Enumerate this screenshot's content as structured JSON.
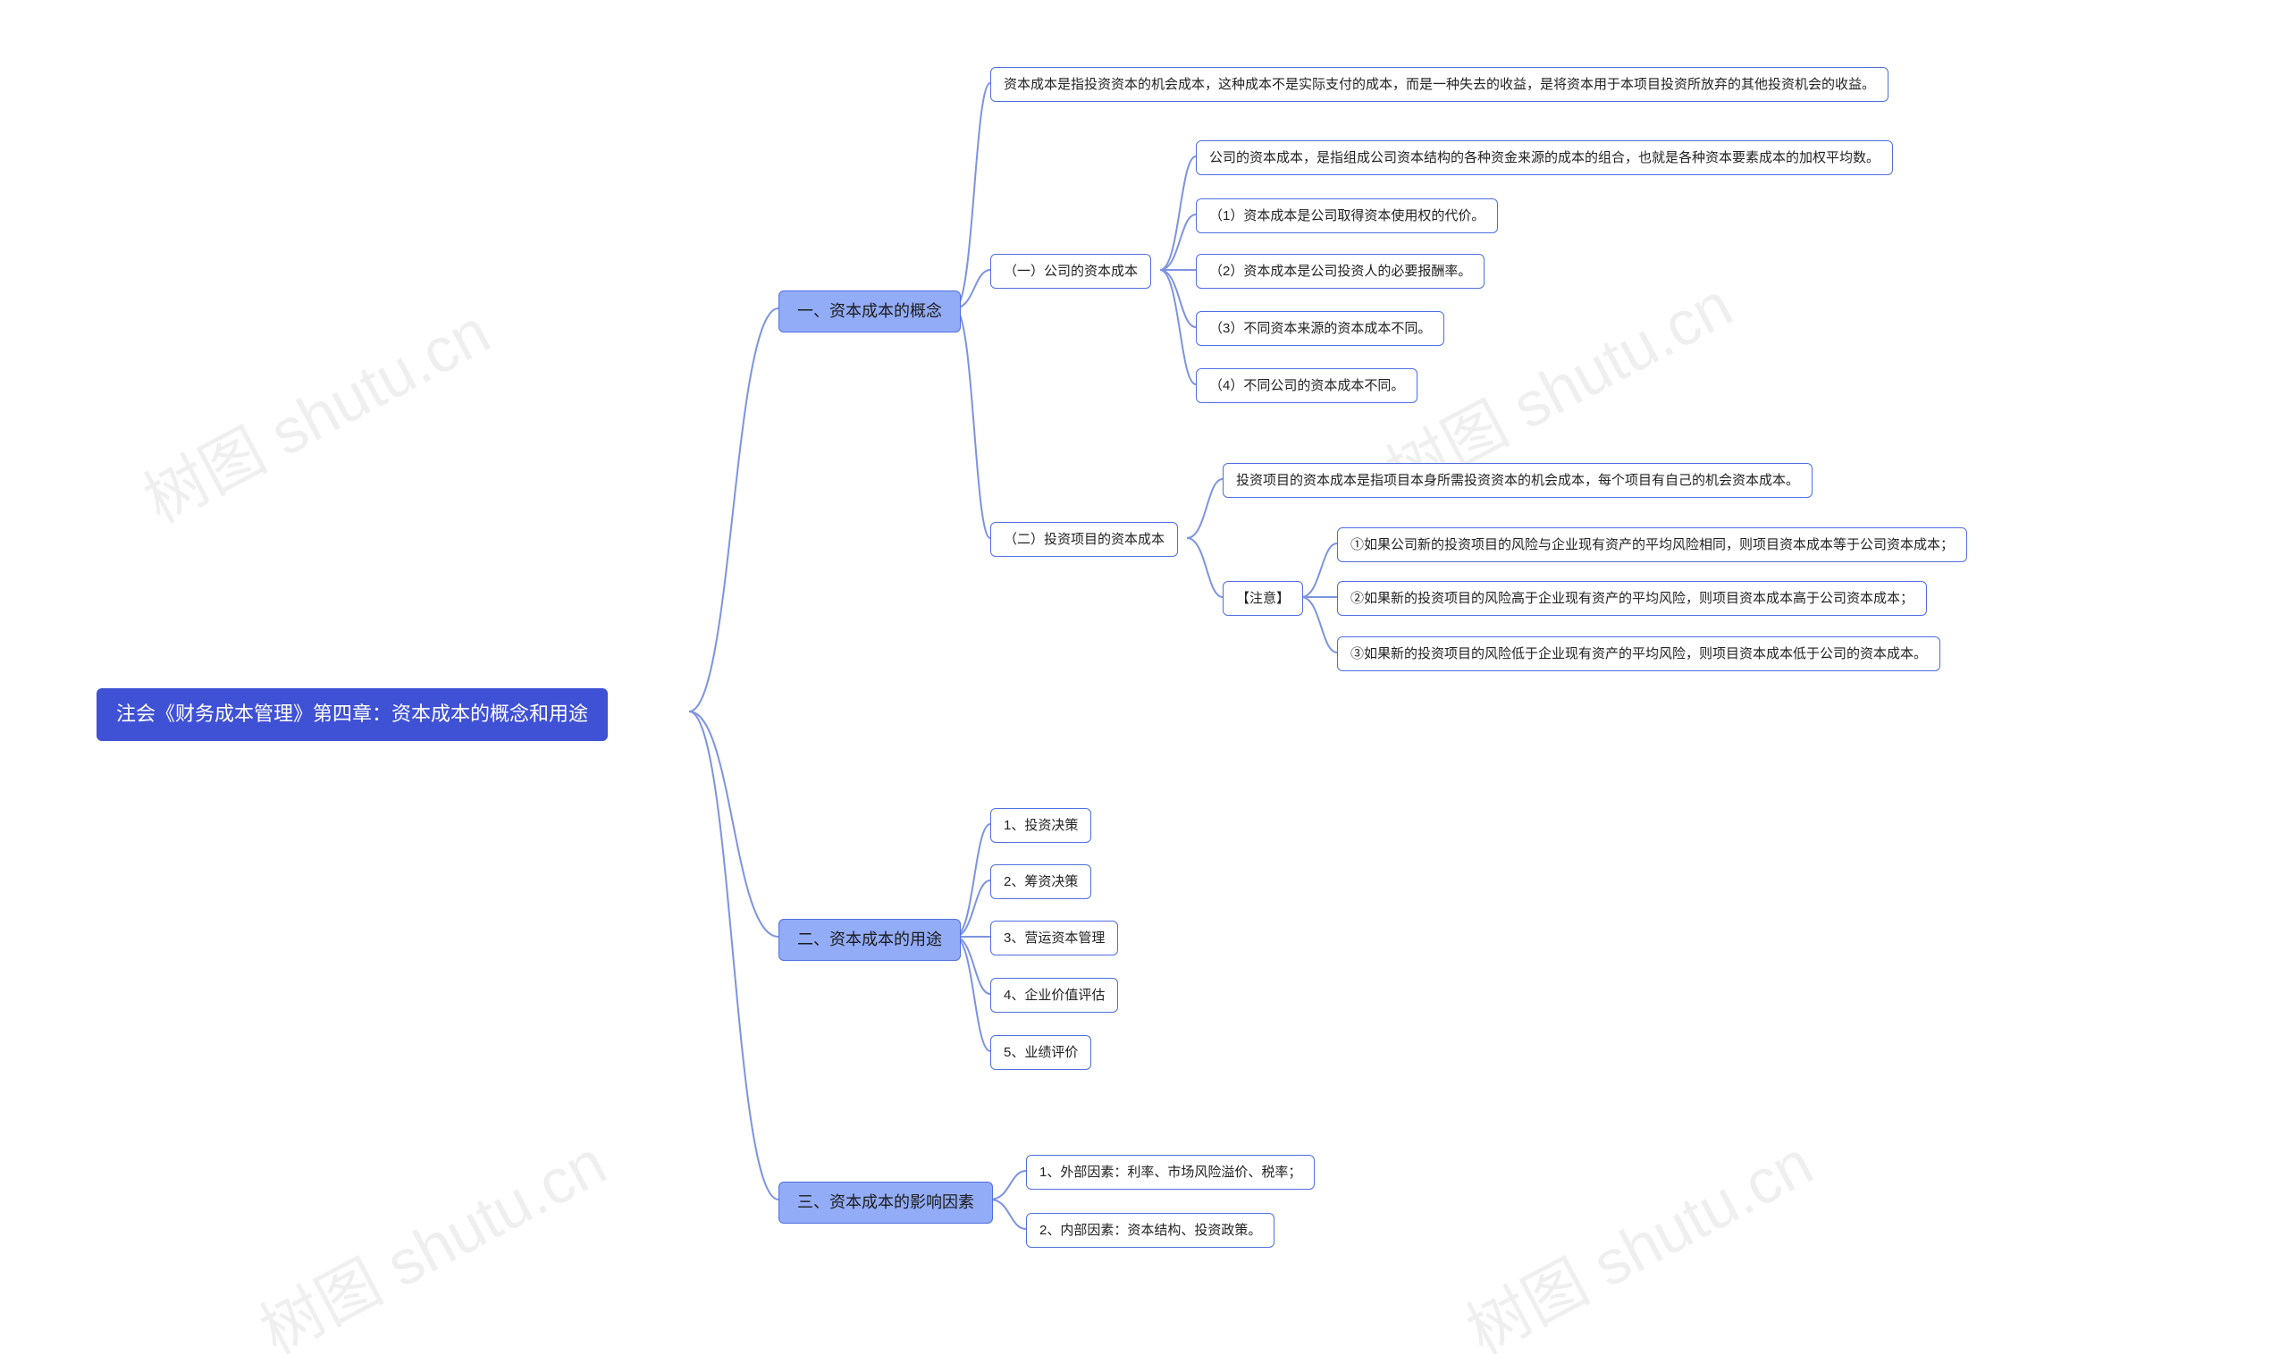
{
  "watermark": "树图 shutu.cn",
  "root": {
    "label": "注会《财务成本管理》第四章：资本成本的概念和用途"
  },
  "level1": {
    "n1": "一、资本成本的概念",
    "n2": "二、资本成本的用途",
    "n3": "三、资本成本的影响因素"
  },
  "n1_leaf_top": "资本成本是指投资资本的机会成本，这种成本不是实际支付的成本，而是一种失去的收益，是将资本用于本项目投资所放弃的其他投资机会的收益。",
  "n1_sub1": "（一）公司的资本成本",
  "n1_sub1_items": {
    "a": "公司的资本成本，是指组成公司资本结构的各种资金来源的成本的组合，也就是各种资本要素成本的加权平均数。",
    "b": "（1）资本成本是公司取得资本使用权的代价。",
    "c": "（2）资本成本是公司投资人的必要报酬率。",
    "d": "（3）不同资本来源的资本成本不同。",
    "e": "（4）不同公司的资本成本不同。"
  },
  "n1_sub2": "（二）投资项目的资本成本",
  "n1_sub2_leaf": "投资项目的资本成本是指项目本身所需投资资本的机会成本，每个项目有自己的机会资本成本。",
  "n1_sub2_note": "【注意】",
  "n1_sub2_note_items": {
    "a": "①如果公司新的投资项目的风险与企业现有资产的平均风险相同，则项目资本成本等于公司资本成本；",
    "b": "②如果新的投资项目的风险高于企业现有资产的平均风险，则项目资本成本高于公司资本成本；",
    "c": "③如果新的投资项目的风险低于企业现有资产的平均风险，则项目资本成本低于公司的资本成本。"
  },
  "n2_items": {
    "a": "1、投资决策",
    "b": "2、筹资决策",
    "c": "3、营运资本管理",
    "d": "4、企业价值评估",
    "e": "5、业绩评价"
  },
  "n3_items": {
    "a": "1、外部因素：利率、市场风险溢价、税率；",
    "b": "2、内部因素：资本结构、投资政策。"
  }
}
